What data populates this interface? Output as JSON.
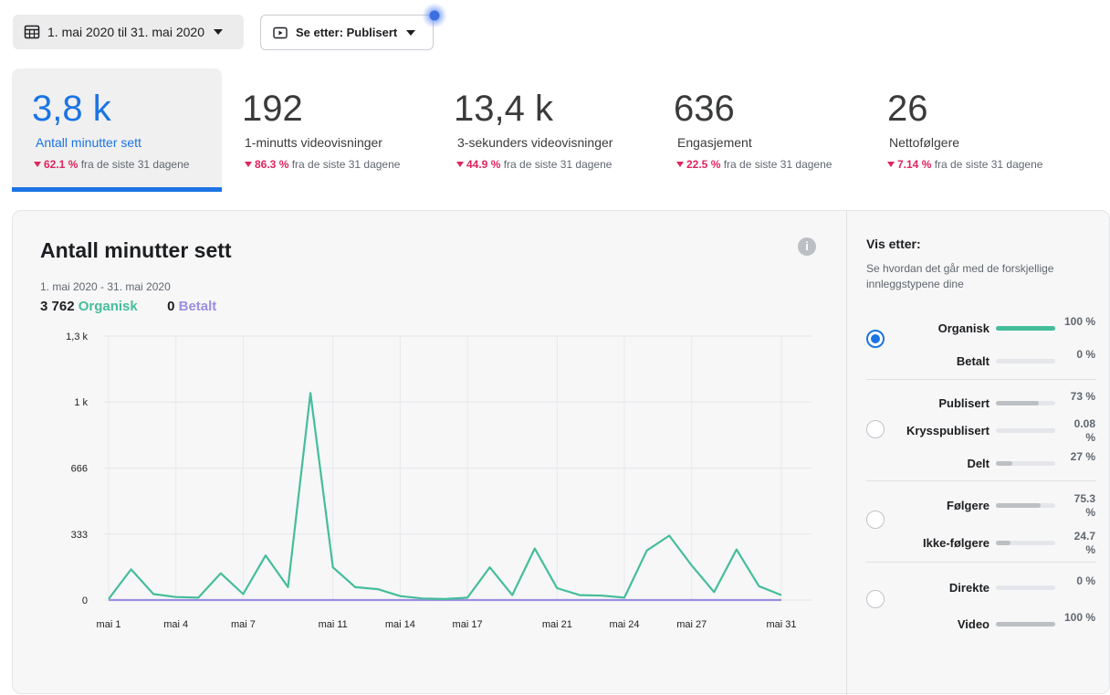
{
  "toolbar": {
    "date_range": "1. mai 2020 til 31. mai 2020",
    "view_label": "Se etter: Publisert"
  },
  "metrics": [
    {
      "value": "3,8 k",
      "label": "Antall minutter sett",
      "change": "62.1 %",
      "suffix": "fra de siste 31 dagene"
    },
    {
      "value": "192",
      "label": "1-minutts videovisninger",
      "change": "86.3 %",
      "suffix": "fra de siste 31 dagene"
    },
    {
      "value": "13,4 k",
      "label": "3-sekunders videovisninger",
      "change": "44.9 %",
      "suffix": "fra de siste 31 dagene"
    },
    {
      "value": "636",
      "label": "Engasjement",
      "change": "22.5 %",
      "suffix": "fra de siste 31 dagene"
    },
    {
      "value": "26",
      "label": "Nettofølgere",
      "change": "7.14 %",
      "suffix": "fra de siste 31 dagene"
    }
  ],
  "chart_section": {
    "title": "Antall minutter sett",
    "date_range": "1. mai 2020 - 31. mai 2020",
    "organic_total": "3 762",
    "organic_label": "Organisk",
    "paid_total": "0",
    "paid_label": "Betalt"
  },
  "chart_data": {
    "type": "line",
    "x": [
      "mai 1",
      "mai 2",
      "mai 3",
      "mai 4",
      "mai 5",
      "mai 6",
      "mai 7",
      "mai 8",
      "mai 9",
      "mai 10",
      "mai 11",
      "mai 12",
      "mai 13",
      "mai 14",
      "mai 15",
      "mai 16",
      "mai 17",
      "mai 18",
      "mai 19",
      "mai 20",
      "mai 21",
      "mai 22",
      "mai 23",
      "mai 24",
      "mai 25",
      "mai 26",
      "mai 27",
      "mai 28",
      "mai 29",
      "mai 30",
      "mai 31"
    ],
    "x_tick_labels": [
      "mai 1",
      "mai 4",
      "mai 7",
      "mai 11",
      "mai 14",
      "mai 17",
      "mai 21",
      "mai 24",
      "mai 27",
      "mai 31"
    ],
    "y_tick_labels": [
      "0",
      "333",
      "666",
      "1 k",
      "1,3 k"
    ],
    "ylim": [
      0,
      1333
    ],
    "series": [
      {
        "name": "Organisk",
        "color": "#45bd9b",
        "values": [
          5,
          155,
          30,
          15,
          12,
          135,
          30,
          225,
          65,
          1045,
          165,
          65,
          55,
          20,
          8,
          5,
          12,
          165,
          25,
          260,
          60,
          25,
          22,
          12,
          250,
          325,
          175,
          40,
          255,
          70,
          25
        ]
      },
      {
        "name": "Betalt",
        "color": "#9b8fe0",
        "values": [
          0,
          0,
          0,
          0,
          0,
          0,
          0,
          0,
          0,
          0,
          0,
          0,
          0,
          0,
          0,
          0,
          0,
          0,
          0,
          0,
          0,
          0,
          0,
          0,
          0,
          0,
          0,
          0,
          0,
          0,
          0
        ]
      }
    ],
    "grid": true
  },
  "panel": {
    "title": "Vis etter:",
    "description": "Se hvordan det går med de forskjellige innleggstypene dine",
    "groups": [
      {
        "selected": true,
        "rows": [
          {
            "label": "Organisk",
            "value": "100 %",
            "fraction": 1.0,
            "color": "#45bd9b"
          },
          {
            "label": "Betalt",
            "value": "0 %",
            "fraction": 0.0,
            "color": "#bcc0c4"
          }
        ]
      },
      {
        "selected": false,
        "rows": [
          {
            "label": "Publisert",
            "value": "73 %",
            "fraction": 0.73,
            "color": "#bcc0c4"
          },
          {
            "label": "Krysspublisert",
            "value": "0.08 %",
            "fraction": 0.0,
            "color": "#bcc0c4"
          },
          {
            "label": "Delt",
            "value": "27 %",
            "fraction": 0.27,
            "color": "#bcc0c4"
          }
        ]
      },
      {
        "selected": false,
        "rows": [
          {
            "label": "Følgere",
            "value": "75.3 %",
            "fraction": 0.753,
            "color": "#bcc0c4"
          },
          {
            "label": "Ikke-følgere",
            "value": "24.7 %",
            "fraction": 0.247,
            "color": "#bcc0c4"
          }
        ]
      },
      {
        "selected": false,
        "rows": [
          {
            "label": "Direkte",
            "value": "0 %",
            "fraction": 0.0,
            "color": "#bcc0c4"
          },
          {
            "label": "Video",
            "value": "100 %",
            "fraction": 1.0,
            "color": "#bcc0c4"
          }
        ]
      }
    ]
  }
}
